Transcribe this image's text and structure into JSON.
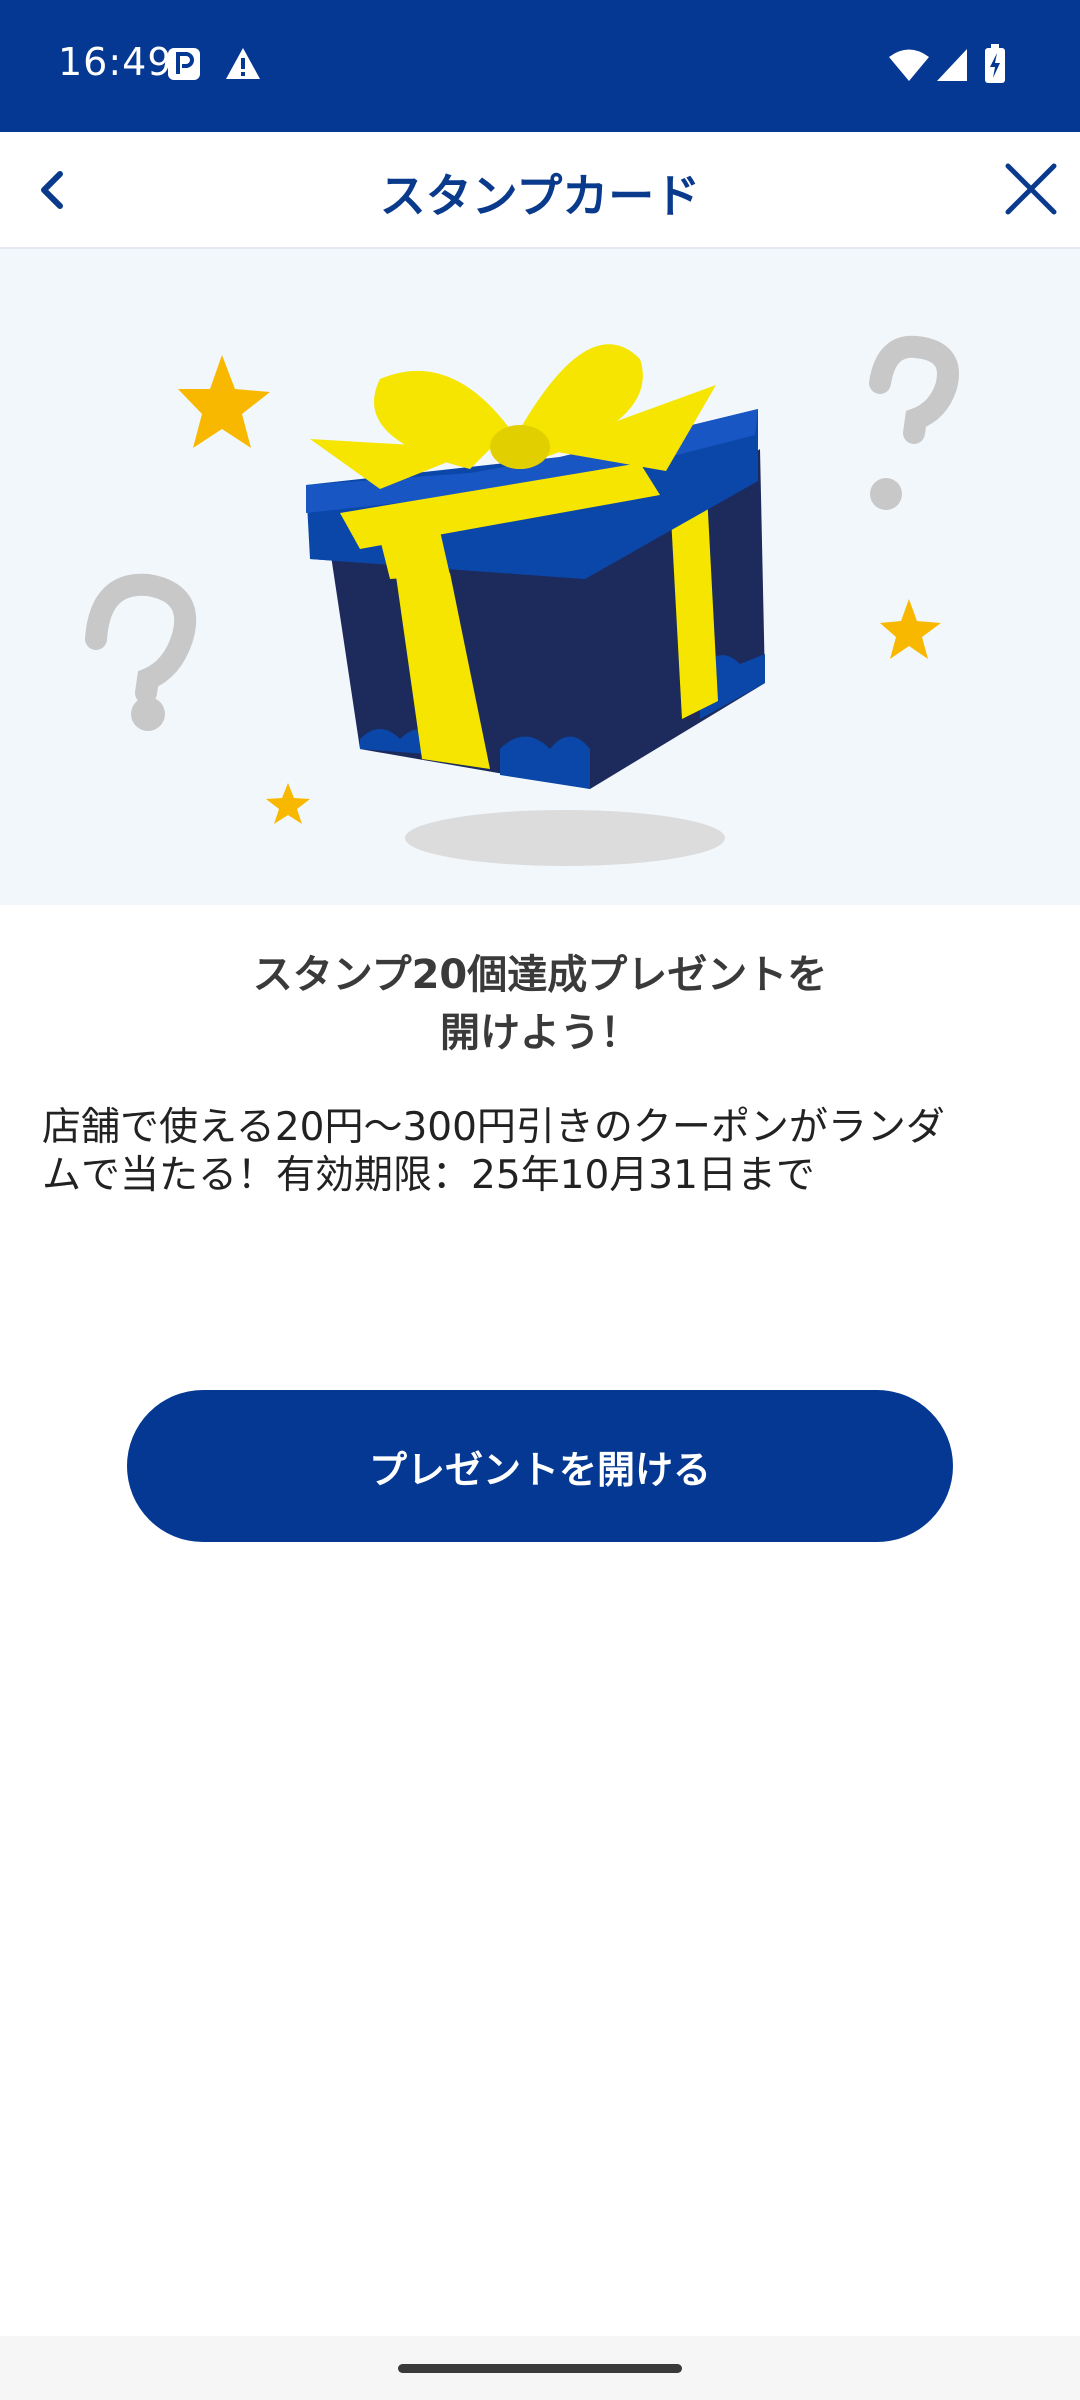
{
  "status_bar": {
    "time": "16:49",
    "icons": [
      "parking-icon",
      "warning-icon",
      "wifi-icon",
      "signal-icon",
      "battery-charging-icon"
    ]
  },
  "header": {
    "title": "スタンプカード",
    "back_icon": "chevron-left-icon",
    "close_icon": "close-icon"
  },
  "hero": {
    "illustration": "gift-box-illustration"
  },
  "content": {
    "headline_line1": "スタンプ20個達成プレゼントを",
    "headline_line2": "開けよう！",
    "description_line1": "店舗で使える20円〜300円引きのクーポンがランダ",
    "description_line2": "ムで当たる！有効期限：25年10月31日まで"
  },
  "actions": {
    "open_button_label": "プレゼントを開ける"
  },
  "colors": {
    "primary": "#043893",
    "title_text": "#0a3a8c",
    "hero_background": "#f1f7fb",
    "ribbon": "#f5e500",
    "star": "#f9b800"
  }
}
